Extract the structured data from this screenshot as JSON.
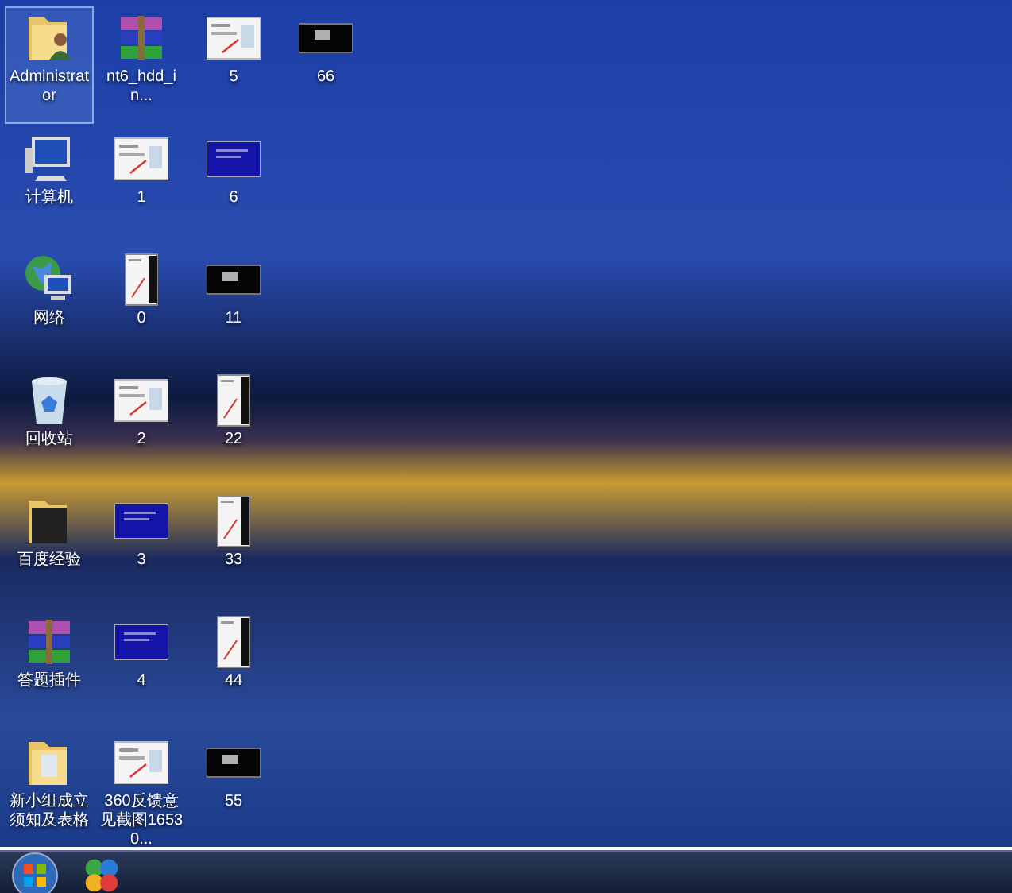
{
  "desktop_icons": [
    {
      "label": "Administrator",
      "kind": "user-folder",
      "selected": true
    },
    {
      "label": "计算机",
      "kind": "computer",
      "selected": false
    },
    {
      "label": "网络",
      "kind": "network",
      "selected": false
    },
    {
      "label": "回收站",
      "kind": "recycle-bin",
      "selected": false
    },
    {
      "label": "百度经验",
      "kind": "folder-dark",
      "selected": false
    },
    {
      "label": "答题插件",
      "kind": "archive",
      "selected": false
    },
    {
      "label": "新小组成立须知及表格",
      "kind": "folder",
      "selected": false
    },
    {
      "label": "nt6_hdd_in...",
      "kind": "archive",
      "selected": false
    },
    {
      "label": "1",
      "kind": "shot-light",
      "selected": false
    },
    {
      "label": "0",
      "kind": "shot-tall",
      "selected": false
    },
    {
      "label": "2",
      "kind": "shot-light",
      "selected": false
    },
    {
      "label": "3",
      "kind": "shot-blue",
      "selected": false
    },
    {
      "label": "4",
      "kind": "shot-blue",
      "selected": false
    },
    {
      "label": "360反馈意见截图16530...",
      "kind": "shot-light",
      "selected": false
    },
    {
      "label": "5",
      "kind": "shot-light",
      "selected": false
    },
    {
      "label": "6",
      "kind": "shot-blue",
      "selected": false
    },
    {
      "label": "11",
      "kind": "shot-dark",
      "selected": false
    },
    {
      "label": "22",
      "kind": "shot-tall",
      "selected": false
    },
    {
      "label": "33",
      "kind": "shot-tall",
      "selected": false
    },
    {
      "label": "44",
      "kind": "shot-tall",
      "selected": false
    },
    {
      "label": "55",
      "kind": "shot-dark",
      "selected": false
    },
    {
      "label": "66",
      "kind": "shot-dark",
      "selected": false
    }
  ],
  "taskbar": {
    "pinned": [
      {
        "kind": "start"
      },
      {
        "kind": "app"
      }
    ]
  }
}
